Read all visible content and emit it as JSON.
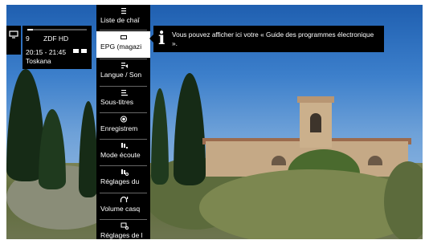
{
  "info_panel": {
    "channel_number": "9",
    "channel_name": "ZDF HD",
    "time": "20:15 - 21:45",
    "program": "Toskana",
    "progress": 0.1
  },
  "menu": {
    "items": [
      {
        "label": "Liste de chaî",
        "icon": "list-icon"
      },
      {
        "label": "EPG (magazi",
        "icon": "epg-icon",
        "selected": true
      },
      {
        "label": "Langue / Son",
        "icon": "audio-language-icon"
      },
      {
        "label": "Sous-titres",
        "icon": "subtitles-icon"
      },
      {
        "label": "Enregistrem",
        "icon": "record-icon"
      },
      {
        "label": "Mode écoute",
        "icon": "listen-mode-icon"
      },
      {
        "label": "Réglages du",
        "icon": "sound-settings-icon"
      },
      {
        "label": "Volume casq",
        "icon": "headphone-volume-icon"
      },
      {
        "label": "Réglages de l",
        "icon": "picture-settings-icon"
      }
    ]
  },
  "tooltip": {
    "text": "Vous pouvez afficher ici votre « Guide des programmes électronique »."
  }
}
